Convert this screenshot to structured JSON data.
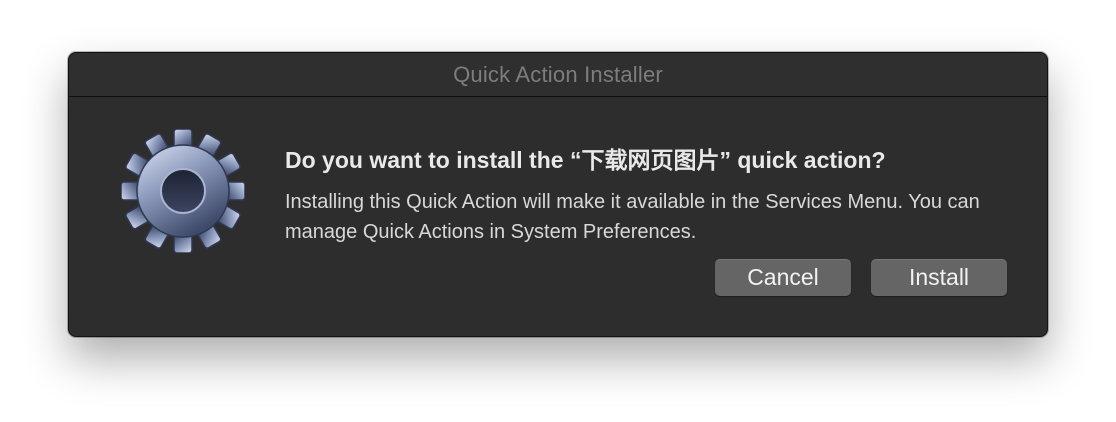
{
  "dialog": {
    "title": "Quick Action Installer",
    "icon": "gear-icon",
    "headline": "Do you want to install the “下载网页图片” quick action?",
    "message": "Installing this Quick Action will make it available in the Services Menu. You can manage Quick Actions in System Preferences.",
    "buttons": {
      "cancel_label": "Cancel",
      "install_label": "Install"
    }
  },
  "colors": {
    "window_background": "#2d2d2d",
    "button_background": "#656565",
    "text_primary": "#e9e9e9"
  }
}
